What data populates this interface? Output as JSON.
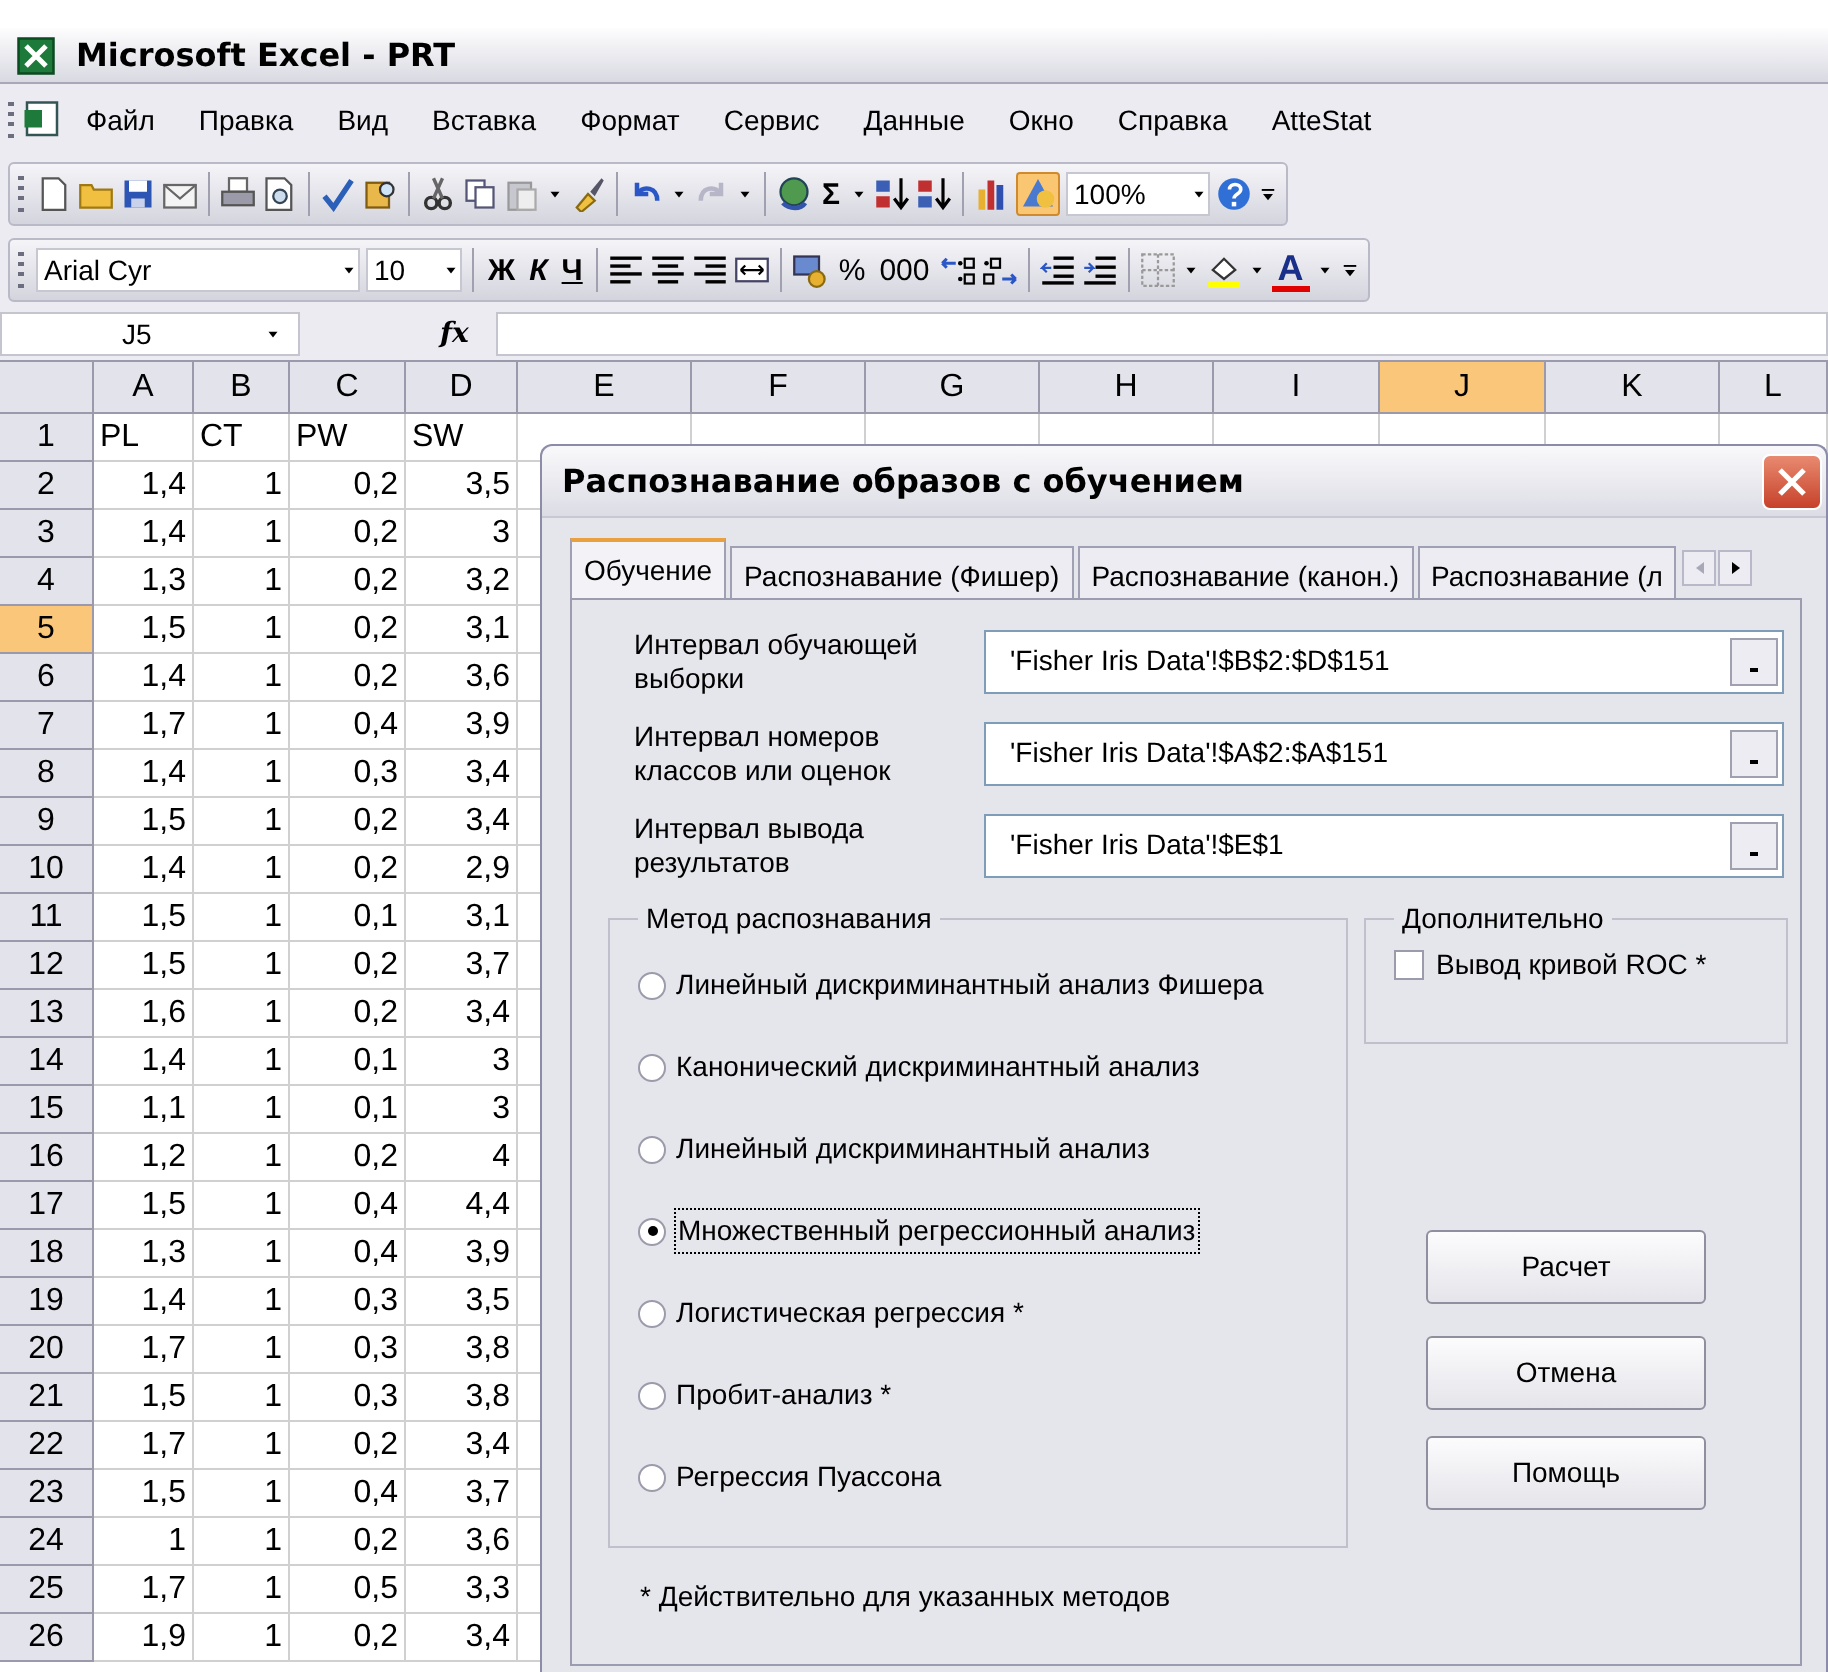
{
  "window": {
    "title": "Microsoft Excel - PRT"
  },
  "menu": [
    "Файл",
    "Правка",
    "Вид",
    "Вставка",
    "Формат",
    "Сервис",
    "Данные",
    "Окно",
    "Справка",
    "AtteStat"
  ],
  "standard_toolbar": {
    "autosum": "Σ",
    "zoom": "100%"
  },
  "formatting_toolbar": {
    "font": "Arial Cyr",
    "size": "10",
    "bold": "Ж",
    "italic": "К",
    "underline": "Ч",
    "percent": "%",
    "thousands": "000",
    "font_color": "A"
  },
  "formula_bar": {
    "cell": "J5",
    "fx": "fx"
  },
  "sheet": {
    "columns": [
      {
        "label": "A",
        "selected": false
      },
      {
        "label": "B",
        "selected": false
      },
      {
        "label": "C",
        "selected": false
      },
      {
        "label": "D",
        "selected": false
      },
      {
        "label": "E",
        "selected": false
      },
      {
        "label": "F",
        "selected": false
      },
      {
        "label": "G",
        "selected": false
      },
      {
        "label": "H",
        "selected": false
      },
      {
        "label": "I",
        "selected": false
      },
      {
        "label": "J",
        "selected": true
      },
      {
        "label": "K",
        "selected": false
      },
      {
        "label": "L",
        "selected": false
      }
    ],
    "rows": [
      {
        "label": "1",
        "selected": false,
        "kind": "text",
        "cells": [
          "PL",
          "CT",
          "PW",
          "SW"
        ]
      },
      {
        "label": "2",
        "selected": false,
        "kind": "number",
        "cells": [
          "1,4",
          "1",
          "0,2",
          "3,5"
        ]
      },
      {
        "label": "3",
        "selected": false,
        "kind": "number",
        "cells": [
          "1,4",
          "1",
          "0,2",
          "3"
        ]
      },
      {
        "label": "4",
        "selected": false,
        "kind": "number",
        "cells": [
          "1,3",
          "1",
          "0,2",
          "3,2"
        ]
      },
      {
        "label": "5",
        "selected": true,
        "kind": "number",
        "cells": [
          "1,5",
          "1",
          "0,2",
          "3,1"
        ]
      },
      {
        "label": "6",
        "selected": false,
        "kind": "number",
        "cells": [
          "1,4",
          "1",
          "0,2",
          "3,6"
        ]
      },
      {
        "label": "7",
        "selected": false,
        "kind": "number",
        "cells": [
          "1,7",
          "1",
          "0,4",
          "3,9"
        ]
      },
      {
        "label": "8",
        "selected": false,
        "kind": "number",
        "cells": [
          "1,4",
          "1",
          "0,3",
          "3,4"
        ]
      },
      {
        "label": "9",
        "selected": false,
        "kind": "number",
        "cells": [
          "1,5",
          "1",
          "0,2",
          "3,4"
        ]
      },
      {
        "label": "10",
        "selected": false,
        "kind": "number",
        "cells": [
          "1,4",
          "1",
          "0,2",
          "2,9"
        ]
      },
      {
        "label": "11",
        "selected": false,
        "kind": "number",
        "cells": [
          "1,5",
          "1",
          "0,1",
          "3,1"
        ]
      },
      {
        "label": "12",
        "selected": false,
        "kind": "number",
        "cells": [
          "1,5",
          "1",
          "0,2",
          "3,7"
        ]
      },
      {
        "label": "13",
        "selected": false,
        "kind": "number",
        "cells": [
          "1,6",
          "1",
          "0,2",
          "3,4"
        ]
      },
      {
        "label": "14",
        "selected": false,
        "kind": "number",
        "cells": [
          "1,4",
          "1",
          "0,1",
          "3"
        ]
      },
      {
        "label": "15",
        "selected": false,
        "kind": "number",
        "cells": [
          "1,1",
          "1",
          "0,1",
          "3"
        ]
      },
      {
        "label": "16",
        "selected": false,
        "kind": "number",
        "cells": [
          "1,2",
          "1",
          "0,2",
          "4"
        ]
      },
      {
        "label": "17",
        "selected": false,
        "kind": "number",
        "cells": [
          "1,5",
          "1",
          "0,4",
          "4,4"
        ]
      },
      {
        "label": "18",
        "selected": false,
        "kind": "number",
        "cells": [
          "1,3",
          "1",
          "0,4",
          "3,9"
        ]
      },
      {
        "label": "19",
        "selected": false,
        "kind": "number",
        "cells": [
          "1,4",
          "1",
          "0,3",
          "3,5"
        ]
      },
      {
        "label": "20",
        "selected": false,
        "kind": "number",
        "cells": [
          "1,7",
          "1",
          "0,3",
          "3,8"
        ]
      },
      {
        "label": "21",
        "selected": false,
        "kind": "number",
        "cells": [
          "1,5",
          "1",
          "0,3",
          "3,8"
        ]
      },
      {
        "label": "22",
        "selected": false,
        "kind": "number",
        "cells": [
          "1,7",
          "1",
          "0,2",
          "3,4"
        ]
      },
      {
        "label": "23",
        "selected": false,
        "kind": "number",
        "cells": [
          "1,5",
          "1",
          "0,4",
          "3,7"
        ]
      },
      {
        "label": "24",
        "selected": false,
        "kind": "number",
        "cells": [
          "1",
          "1",
          "0,2",
          "3,6"
        ]
      },
      {
        "label": "25",
        "selected": false,
        "kind": "number",
        "cells": [
          "1,7",
          "1",
          "0,5",
          "3,3"
        ]
      },
      {
        "label": "26",
        "selected": false,
        "kind": "number",
        "cells": [
          "1,9",
          "1",
          "0,2",
          "3,4"
        ]
      }
    ]
  },
  "dialog": {
    "title": "Распознавание образов с обучением",
    "tabs": [
      {
        "label": "Обучение",
        "selected": true
      },
      {
        "label": "Распознавание (Фишер)",
        "selected": false
      },
      {
        "label": "Распознавание (канон.)",
        "selected": false
      },
      {
        "label": "Распознавание (л",
        "selected": false
      }
    ],
    "fields": [
      {
        "label": "Интервал обучающей выборки",
        "value": "'Fisher Iris Data'!$B$2:$D$151"
      },
      {
        "label": "Интервал номеров классов или оценок",
        "value": "'Fisher Iris Data'!$A$2:$A$151"
      },
      {
        "label": "Интервал вывода результатов",
        "value": "'Fisher Iris Data'!$E$1"
      }
    ],
    "method_group": {
      "title": "Метод распознавания",
      "options": [
        {
          "label": "Линейный дискриминантный анализ Фишера",
          "selected": false
        },
        {
          "label": "Канонический дискриминантный анализ",
          "selected": false
        },
        {
          "label": "Линейный дискриминантный анализ",
          "selected": false
        },
        {
          "label": "Множественный регрессионный анализ",
          "selected": true
        },
        {
          "label": "Логистическая регрессия *",
          "selected": false
        },
        {
          "label": "Пробит-анализ *",
          "selected": false
        },
        {
          "label": "Регрессия Пуассона",
          "selected": false
        }
      ]
    },
    "extra_group": {
      "title": "Дополнительно",
      "checkbox": {
        "label": "Вывод кривой ROC *",
        "checked": false
      }
    },
    "buttons": [
      "Расчет",
      "Отмена",
      "Помощь"
    ],
    "footnote": "* Действительно для указанных методов"
  }
}
